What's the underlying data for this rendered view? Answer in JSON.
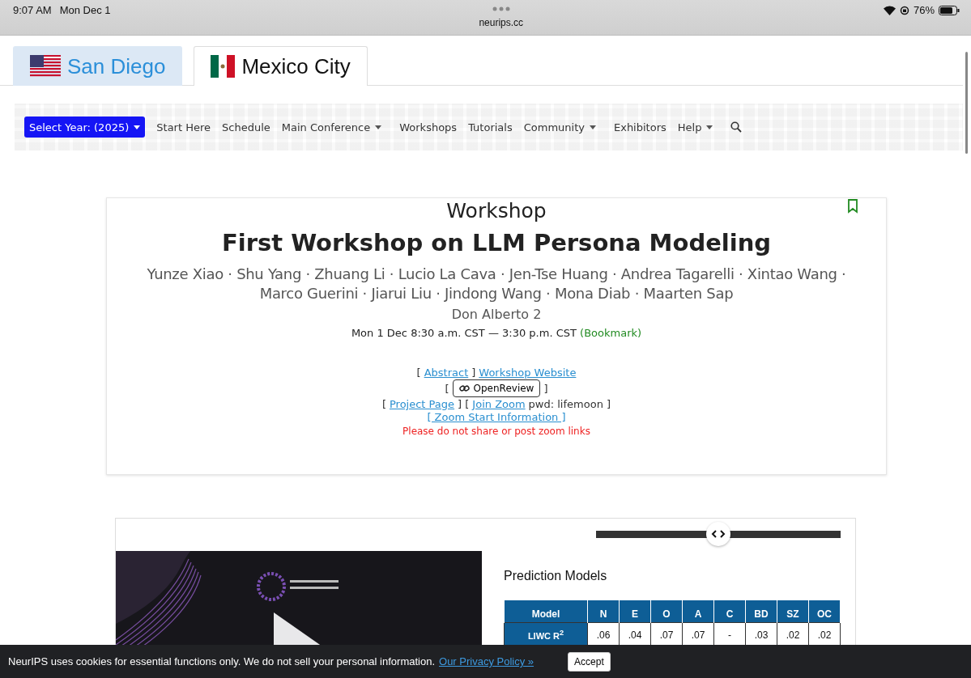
{
  "status_bar": {
    "time": "9:07 AM",
    "date": "Mon Dec 1",
    "url": "neurips.cc",
    "battery": "76%"
  },
  "city_tabs": [
    {
      "label": "San Diego",
      "kind": "us",
      "selected": false
    },
    {
      "label": "Mexico City",
      "kind": "mx",
      "selected": true
    }
  ],
  "nav": {
    "year_button": "Select Year: (2025)",
    "items": [
      {
        "label": "Start Here",
        "dropdown": false
      },
      {
        "label": "Schedule",
        "dropdown": false
      },
      {
        "label": "Main Conference",
        "dropdown": true
      },
      {
        "label": "Workshops",
        "dropdown": false
      },
      {
        "label": "Tutorials",
        "dropdown": false
      },
      {
        "label": "Community",
        "dropdown": true
      },
      {
        "label": "Exhibitors",
        "dropdown": false
      },
      {
        "label": "Help",
        "dropdown": true
      }
    ]
  },
  "event": {
    "type": "Workshop",
    "title": "First Workshop on LLM Persona Modeling",
    "authors": "Yunze Xiao · Shu Yang · Zhuang Li · Lucio La Cava · Jen-Tse Huang · Andrea Tagarelli · Xintao Wang · Marco Guerini · Jiarui Liu · Jindong Wang · Mona Diab · Maarten Sap",
    "room": "Don Alberto 2",
    "time": "Mon 1 Dec 8:30 a.m. CST — 3:30 p.m. CST",
    "bookmark": "(Bookmark)",
    "links": [
      [
        {
          "kind": "text",
          "text": "["
        },
        {
          "kind": "link",
          "text": "Abstract "
        },
        {
          "kind": "text",
          "text": "]"
        },
        {
          "kind": "link",
          "text": "Workshop Website"
        }
      ],
      [
        {
          "kind": "text",
          "text": "["
        },
        {
          "kind": "button",
          "text": "OpenReview"
        },
        {
          "kind": "text",
          "text": "]"
        }
      ],
      [
        {
          "kind": "text",
          "text": "["
        },
        {
          "kind": "link",
          "text": "Project Page "
        },
        {
          "kind": "text",
          "text": "] ["
        },
        {
          "kind": "link",
          "text": "Join Zoom"
        },
        {
          "kind": "text",
          "text": "pwd: lifemoon ]"
        }
      ],
      [
        {
          "kind": "link",
          "text": "[ Zoom Start Information ]"
        }
      ]
    ],
    "warning": "Please do not share or post zoom links"
  },
  "comparison": {
    "level": 0.5,
    "slide": {
      "heading": "Prediction Models",
      "columns": [
        "Model",
        "N",
        "E",
        "O",
        "A",
        "C",
        "BD",
        "SZ",
        "OC"
      ],
      "rows": [
        [
          "LIWC R$^{2}$",
          ".06",
          ".04",
          ".07",
          ".07",
          "-",
          ".03",
          ".02",
          ".02"
        ]
      ]
    }
  },
  "cookie_banner": {
    "text": "NeurIPS uses cookies for essential functions only. We do not sell your personal information.",
    "link": "Our Privacy Policy »",
    "button": "Accept"
  }
}
